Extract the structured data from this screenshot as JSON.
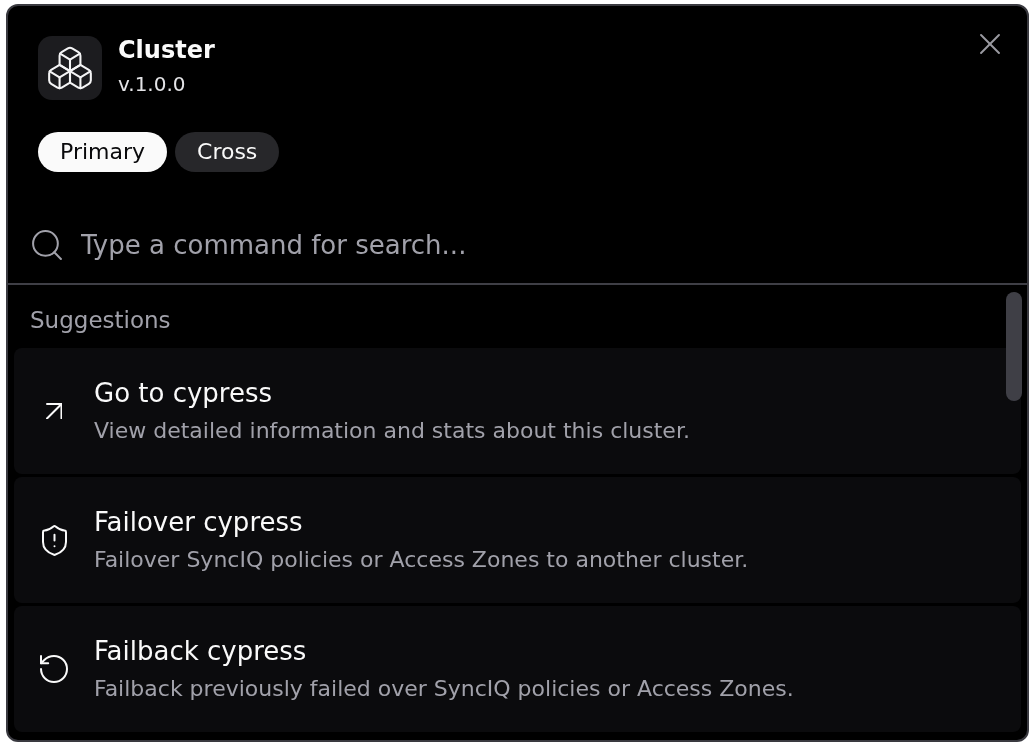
{
  "app": {
    "name": "Cluster",
    "version": "v.1.0.0"
  },
  "tabs": [
    {
      "label": "Primary",
      "selected": true
    },
    {
      "label": "Cross",
      "selected": false
    }
  ],
  "search": {
    "placeholder": "Type a command for search..."
  },
  "suggestions": {
    "heading": "Suggestions",
    "items": [
      {
        "kind": "navigate",
        "title": "Go to cypress",
        "description": "View detailed information and stats about this cluster."
      },
      {
        "kind": "failover",
        "title": "Failover cypress",
        "description": "Failover SyncIQ policies or Access Zones to another cluster."
      },
      {
        "kind": "failback",
        "title": "Failback cypress",
        "description": "Failback previously failed over SyncIQ policies or Access Zones."
      }
    ]
  }
}
